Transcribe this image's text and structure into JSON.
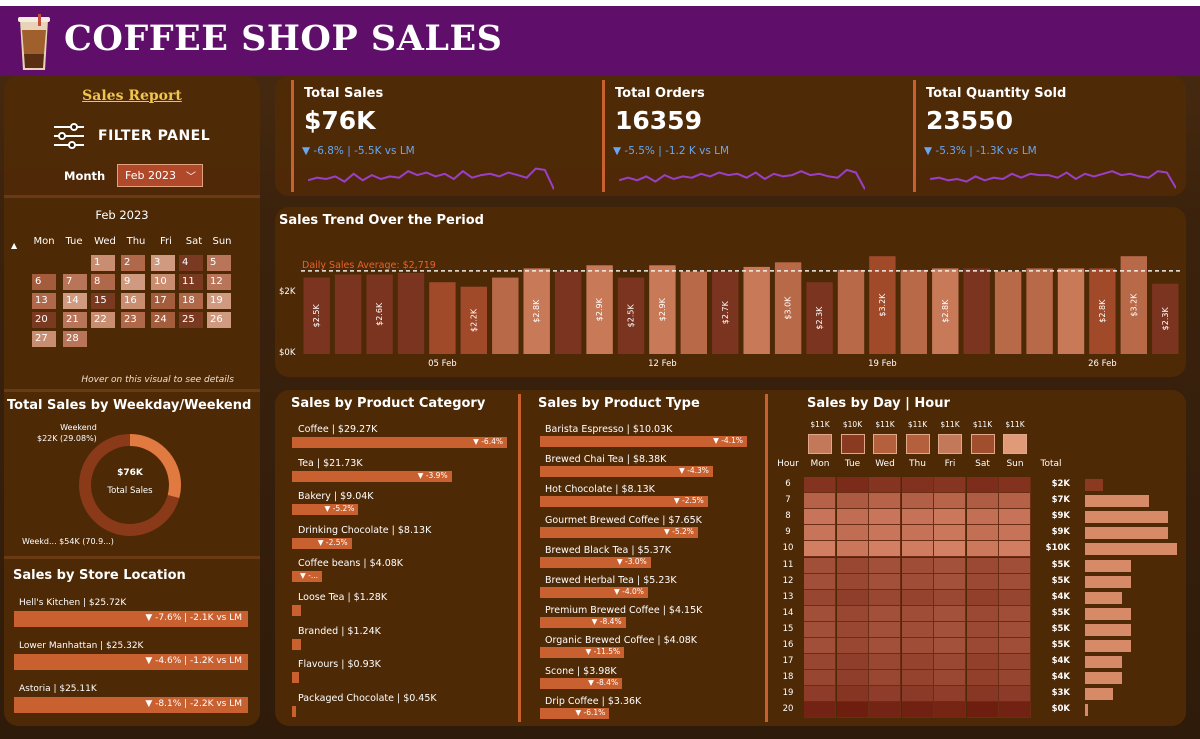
{
  "header": {
    "title": "COFFEE SHOP SALES"
  },
  "filter": {
    "report_link": "Sales Report",
    "panel_label": "FILTER PANEL",
    "month_label": "Month",
    "month_value": "Feb 2023"
  },
  "calendar": {
    "title": "Feb 2023",
    "weekdays": [
      "Mon",
      "Tue",
      "Wed",
      "Thu",
      "Fri",
      "Sat",
      "Sun"
    ],
    "days": [
      "1",
      "2",
      "3",
      "4",
      "5",
      "6",
      "7",
      "8",
      "9",
      "10",
      "11",
      "12",
      "13",
      "14",
      "15",
      "16",
      "17",
      "18",
      "19",
      "20",
      "21",
      "22",
      "23",
      "24",
      "25",
      "26",
      "27",
      "28"
    ],
    "hint": "Hover on this visual to see details"
  },
  "weekday_weekend": {
    "title": "Total Sales by Weekday/Weekend",
    "weekend_label": "Weekend",
    "weekend_value": "$22K (29.08%)",
    "weekday_label": "Weekd... $54K (70.9...)",
    "center_value": "$76K",
    "center_label": "Total Sales",
    "weekend_share": 0.2908
  },
  "store_location": {
    "title": "Sales by Store Location",
    "items": [
      {
        "name": "Hell's Kitchen | $25.72K",
        "delta": "▼ -7.6% | -2.1K vs LM"
      },
      {
        "name": "Lower Manhattan | $25.32K",
        "delta": "▼ -4.6% | -1.2K vs LM"
      },
      {
        "name": "Astoria | $25.11K",
        "delta": "▼ -8.1% | -2.2K vs LM"
      }
    ]
  },
  "kpis": [
    {
      "title": "Total Sales",
      "value": "$76K",
      "delta": "▼ -6.8% | -5.5K vs LM"
    },
    {
      "title": "Total Orders",
      "value": "16359",
      "delta": "▼ -5.5% | -1.2 K vs LM"
    },
    {
      "title": "Total Quantity Sold",
      "value": "23550",
      "delta": "▼ -5.3% | -1.3K vs LM"
    }
  ],
  "colors": {
    "accent": "#c9602f",
    "header": "#5f0f6a",
    "panel": "#502a06",
    "sparkline": "#9b3fc6",
    "delta": "#6aa7ee"
  },
  "chart_data": [
    {
      "type": "bar",
      "title": "Sales Trend Over the Period",
      "average_label": "Daily Sales Average: $2,719",
      "average": 2719,
      "x": [
        "01 Feb",
        "02 Feb",
        "03 Feb",
        "04 Feb",
        "05 Feb",
        "06 Feb",
        "07 Feb",
        "08 Feb",
        "09 Feb",
        "10 Feb",
        "11 Feb",
        "12 Feb",
        "13 Feb",
        "14 Feb",
        "15 Feb",
        "16 Feb",
        "17 Feb",
        "18 Feb",
        "19 Feb",
        "20 Feb",
        "21 Feb",
        "22 Feb",
        "23 Feb",
        "24 Feb",
        "25 Feb",
        "26 Feb",
        "27 Feb",
        "28 Feb"
      ],
      "values": [
        2500,
        2600,
        2600,
        2650,
        2350,
        2200,
        2500,
        2800,
        2700,
        2900,
        2500,
        2900,
        2700,
        2700,
        2850,
        3000,
        2350,
        2750,
        3200,
        2750,
        2800,
        2800,
        2700,
        2800,
        2800,
        2800,
        3200,
        2300
      ],
      "data_labels": [
        "$2.5K",
        "",
        "$2.6K",
        "",
        "",
        "$2.2K",
        "",
        "$2.8K",
        "",
        "$2.9K",
        "$2.5K",
        "$2.9K",
        "",
        "$2.7K",
        "",
        "$3.0K",
        "$2.3K",
        "",
        "$3.2K",
        "",
        "$2.8K",
        "",
        "",
        "",
        "",
        "$2.8K",
        "$3.2K",
        "$2.3K"
      ],
      "x_ticks": [
        "05 Feb",
        "12 Feb",
        "19 Feb",
        "26 Feb"
      ],
      "y_ticks": [
        "$0K",
        "$2K"
      ],
      "ylim": [
        0,
        3500
      ]
    },
    {
      "type": "bar",
      "title": "Sales by Product Category",
      "items": [
        {
          "label": "Coffee | $29.27K",
          "value": 29.27,
          "delta": "▼ -6.4%"
        },
        {
          "label": "Tea | $21.73K",
          "value": 21.73,
          "delta": "▼ -3.9%"
        },
        {
          "label": "Bakery | $9.04K",
          "value": 9.04,
          "delta": "▼ -5.2%"
        },
        {
          "label": "Drinking Chocolate | $8.13K",
          "value": 8.13,
          "delta": "▼ -2.5%"
        },
        {
          "label": "Coffee beans | $4.08K",
          "value": 4.08,
          "delta": "▼ -..."
        },
        {
          "label": "Loose Tea | $1.28K",
          "value": 1.28,
          "delta": ""
        },
        {
          "label": "Branded | $1.24K",
          "value": 1.24,
          "delta": ""
        },
        {
          "label": "Flavours | $0.93K",
          "value": 0.93,
          "delta": ""
        },
        {
          "label": "Packaged Chocolate | $0.45K",
          "value": 0.45,
          "delta": ""
        }
      ]
    },
    {
      "type": "bar",
      "title": "Sales by Product Type",
      "items": [
        {
          "label": "Barista Espresso | $10.03K",
          "value": 10.03,
          "delta": "▼ -4.1%"
        },
        {
          "label": "Brewed Chai Tea | $8.38K",
          "value": 8.38,
          "delta": "▼ -4.3%"
        },
        {
          "label": "Hot Chocolate | $8.13K",
          "value": 8.13,
          "delta": "▼ -2.5%"
        },
        {
          "label": "Gourmet Brewed Coffee | $7.65K",
          "value": 7.65,
          "delta": "▼ -5.2%"
        },
        {
          "label": "Brewed Black Tea | $5.37K",
          "value": 5.37,
          "delta": "▼ -3.0%"
        },
        {
          "label": "Brewed Herbal Tea | $5.23K",
          "value": 5.23,
          "delta": "▼ -4.0%"
        },
        {
          "label": "Premium Brewed Coffee | $4.15K",
          "value": 4.15,
          "delta": "▼ -8.4%"
        },
        {
          "label": "Organic Brewed Coffee | $4.08K",
          "value": 4.08,
          "delta": "▼ -11.5%"
        },
        {
          "label": "Scone | $3.98K",
          "value": 3.98,
          "delta": "▼ -8.4%"
        },
        {
          "label": "Drip Coffee | $3.36K",
          "value": 3.36,
          "delta": "▼ -6.1%"
        }
      ]
    },
    {
      "type": "heatmap",
      "title": "Sales by Day | Hour",
      "days": [
        "Mon",
        "Tue",
        "Wed",
        "Thu",
        "Fri",
        "Sat",
        "Sun"
      ],
      "day_totals": [
        "$11K",
        "$10K",
        "$11K",
        "$11K",
        "$11K",
        "$11K",
        "$11K"
      ],
      "hour_label": "Hour",
      "total_label": "Total",
      "hours": [
        "6",
        "7",
        "8",
        "9",
        "10",
        "11",
        "12",
        "13",
        "14",
        "15",
        "16",
        "17",
        "18",
        "19",
        "20"
      ],
      "hour_totals": [
        "$2K",
        "$7K",
        "$9K",
        "$9K",
        "$10K",
        "$5K",
        "$5K",
        "$4K",
        "$5K",
        "$5K",
        "$5K",
        "$4K",
        "$4K",
        "$3K",
        "$0K"
      ],
      "hour_values": [
        2,
        7,
        9,
        9,
        10,
        5,
        5,
        4,
        5,
        5,
        5,
        4,
        4,
        3,
        0.3
      ]
    }
  ]
}
